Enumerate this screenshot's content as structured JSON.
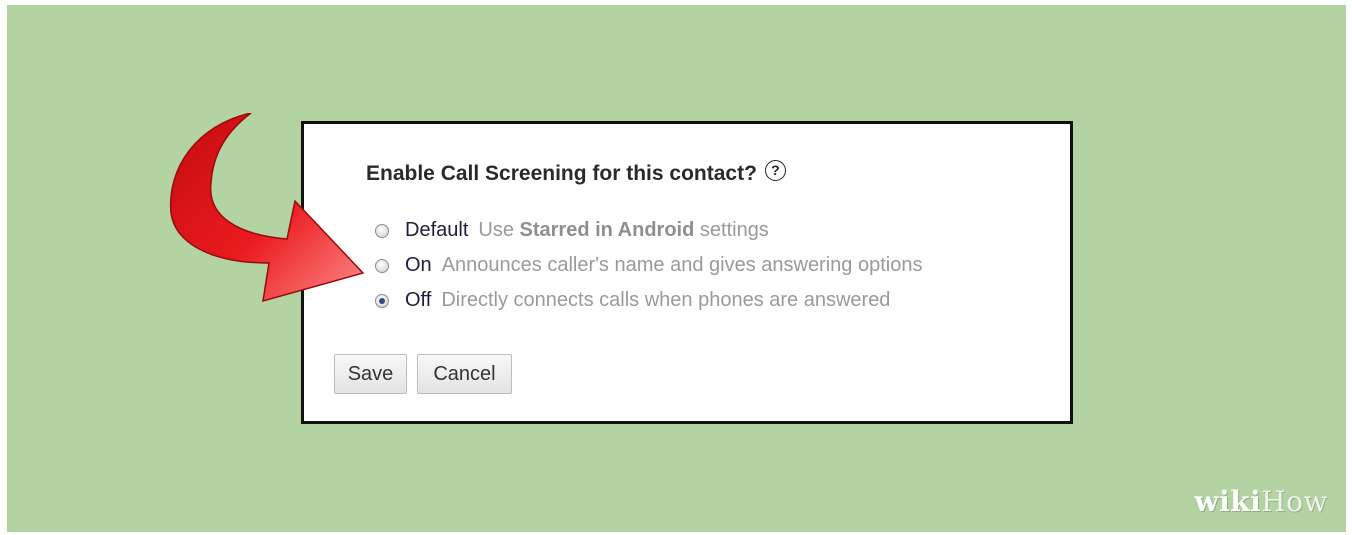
{
  "dialog": {
    "title": "Enable Call Screening for this contact?",
    "help_glyph": "?",
    "options": [
      {
        "label": "Default",
        "description_pre": "Use ",
        "description_bold": "Starred in Android",
        "description_post": " settings",
        "selected": false
      },
      {
        "label": "On",
        "description": "Announces caller's name and gives answering options",
        "selected": false
      },
      {
        "label": "Off",
        "description": "Directly connects calls when phones are answered",
        "selected": true
      }
    ],
    "save_label": "Save",
    "cancel_label": "Cancel"
  },
  "watermark": {
    "part1": "wiki",
    "part2": "How"
  },
  "colors": {
    "background": "#b3d3a2",
    "arrow": "#e8191c",
    "dialog_border": "#111111"
  },
  "icons": {
    "arrow": "red-curved-arrow-icon",
    "help": "help-circle-icon"
  }
}
